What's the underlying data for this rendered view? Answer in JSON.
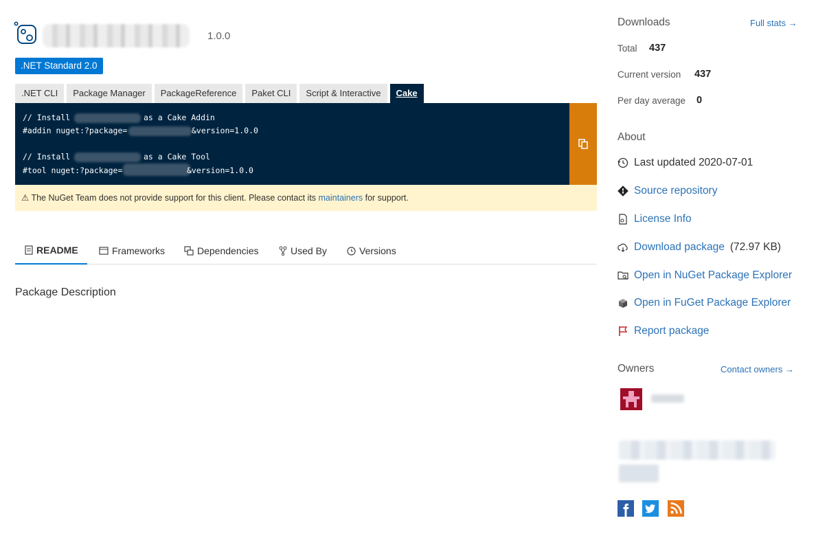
{
  "header": {
    "version": "1.0.0",
    "framework_badge": ".NET Standard 2.0"
  },
  "install": {
    "tabs": [
      ".NET CLI",
      "Package Manager",
      "PackageReference",
      "Paket CLI",
      "Script & Interactive",
      "Cake"
    ],
    "active_tab": "Cake",
    "code": {
      "line1_start": "// Install ",
      "line1_end": "as a Cake Addin",
      "line2_start": "#addin nuget:?package=",
      "line2_end": "&version=1.0.0",
      "line3_start": "// Install ",
      "line3_end": "as a Cake Tool",
      "line4_start": "#tool nuget:?package=",
      "line4_end": "&version=1.0.0"
    },
    "copy_icon": "copy-icon",
    "warning": {
      "text_before": "The NuGet Team does not provide support for this client. Please contact its ",
      "link": "maintainers",
      "text_after": " for support."
    }
  },
  "body_tabs": {
    "readme": "README",
    "frameworks": "Frameworks",
    "dependencies": "Dependencies",
    "used_by": "Used By",
    "versions": "Versions"
  },
  "readme": {
    "description": "Package Description"
  },
  "sidebar": {
    "downloads": {
      "title": "Downloads",
      "full_stats": "Full stats →",
      "total_label": "Total",
      "total_value": "437",
      "current_label": "Current version",
      "current_value": "437",
      "per_day_label": "Per day average",
      "per_day_value": "0"
    },
    "about": {
      "title": "About",
      "last_updated": "Last updated 2020-07-01",
      "source_repository": "Source repository",
      "license_info": "License Info",
      "download_package": "Download package",
      "download_size": "(72.97 KB)",
      "open_nuget_explorer": "Open in NuGet Package Explorer",
      "open_fuget_explorer": "Open in FuGet Package Explorer",
      "report_package": "Report package"
    },
    "owners": {
      "title": "Owners",
      "contact_owners": "Contact owners →"
    }
  },
  "colors": {
    "accent": "#0078d4",
    "link": "#2c72b6",
    "code_bg": "#002440",
    "copy_bg": "#d87d0c",
    "warning_bg": "#fff4ce"
  }
}
